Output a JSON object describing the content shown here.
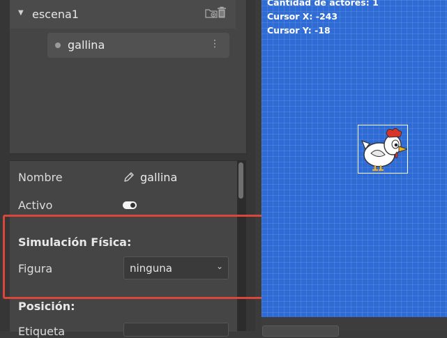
{
  "tree": {
    "scene_label": "escena1",
    "actor_label": "gallina",
    "actor_menu_glyph": "⋮"
  },
  "properties": {
    "name_label": "Nombre",
    "name_value": "gallina",
    "active_label": "Activo",
    "active_value": true,
    "physics_title": "Simulación Física:",
    "shape_label": "Figura",
    "shape_value": "ninguna",
    "position_title": "Posición:",
    "next_label_partial": "Etiqueta"
  },
  "canvas": {
    "actor_count": "Cantidad de actores: 1",
    "cursor_x": "Cursor X: -243",
    "cursor_y": "Cursor Y: -18"
  },
  "colors": {
    "canvas_bg": "#2f6bd4",
    "highlight": "#d9473b",
    "panel_bg": "#444544"
  },
  "icons": [
    "chevron-down-icon",
    "folder-add-icon",
    "trash-icon",
    "pencil-icon",
    "toggle-icon",
    "chevron-down-icon",
    "kebab-menu-icon"
  ]
}
